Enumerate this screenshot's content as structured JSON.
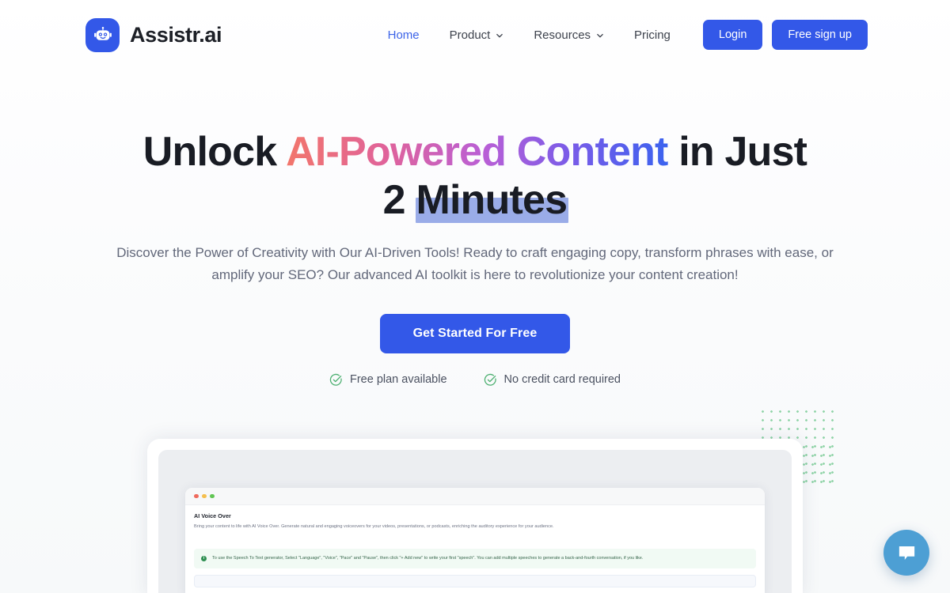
{
  "brand": {
    "name": "Assistr.ai",
    "logo_icon": "robot-face-icon",
    "logo_color": "#3358e8"
  },
  "nav": {
    "links": [
      {
        "label": "Home",
        "active": true,
        "has_dropdown": false
      },
      {
        "label": "Product",
        "active": false,
        "has_dropdown": true
      },
      {
        "label": "Resources",
        "active": false,
        "has_dropdown": true
      },
      {
        "label": "Pricing",
        "active": false,
        "has_dropdown": false
      }
    ],
    "login_label": "Login",
    "signup_label": "Free sign up",
    "button_color": "#3358e8",
    "active_link_color": "#3c63e8"
  },
  "hero": {
    "title_part1": "Unlock ",
    "title_gradient": "AI-Powered Content",
    "title_part2": " in Just 2 ",
    "title_highlight": "Minutes",
    "gradient_start": "#f2766b",
    "gradient_end": "#3b62ef",
    "highlight_color": "#9aace8",
    "subtitle": "Discover the Power of Creativity with Our AI-Driven Tools! Ready to craft engaging copy, transform phrases with ease, or amplify your SEO? Our advanced AI toolkit is here to revolutionize your content creation!",
    "cta_label": "Get Started For Free",
    "badges": [
      {
        "label": "Free plan available",
        "icon": "check-circle-icon"
      },
      {
        "label": "No credit card required",
        "icon": "check-circle-icon"
      }
    ],
    "badge_icon_color": "#4caf70"
  },
  "preview": {
    "app_title": "AI Voice Over",
    "app_description": "Bring your content to life with AI Voice Over. Generate natural and engaging voiceovers for your videos, presentations, or podcasts, enriching the auditory experience for your audience.",
    "info_marker": "i",
    "info_text": "To use the Speech To Text generator, Select \"Language\", \"Voice\", \"Pace\" and \"Pause\", then click \"+ Add new\" to write your first \"speech\". You can add multiple speeches to generate a back-and-fourth conversation, if you like.",
    "window_dots": [
      "red",
      "yellow",
      "green"
    ],
    "decor_dot_color": "#8ed3a6"
  },
  "chat": {
    "icon": "chat-bubble-icon",
    "color": "#4d9fd4"
  }
}
